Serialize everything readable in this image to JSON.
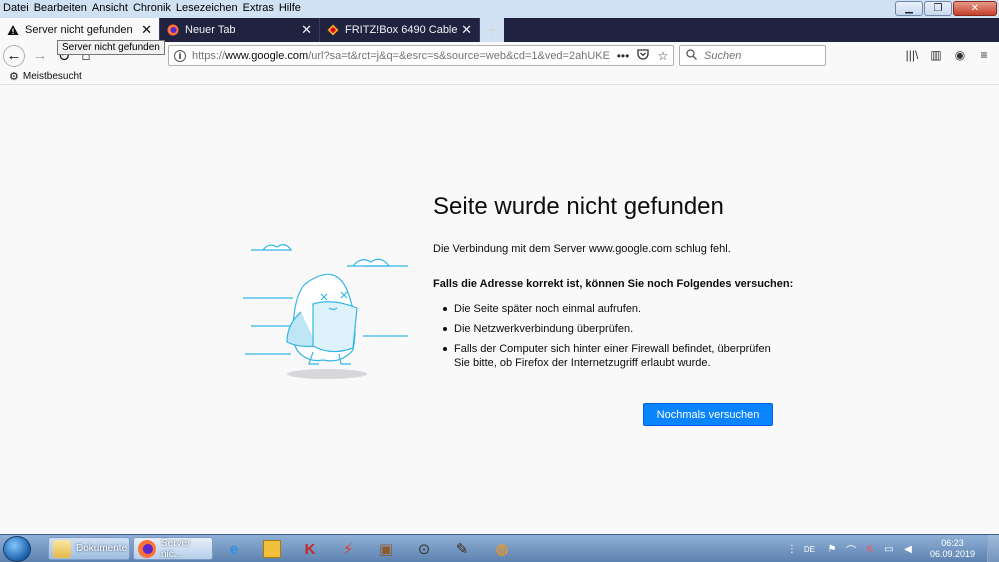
{
  "menubar": {
    "items": [
      "Datei",
      "Bearbeiten",
      "Ansicht",
      "Chronik",
      "Lesezeichen",
      "Extras",
      "Hilfe"
    ]
  },
  "tabs": [
    {
      "label": "Server nicht gefunden",
      "active": true,
      "icon": "warning-icon"
    },
    {
      "label": "Neuer Tab",
      "active": false,
      "icon": "firefox-icon"
    },
    {
      "label": "FRITZ!Box 6490 Cable",
      "active": false,
      "icon": "fritzbox-icon"
    }
  ],
  "tooltip": "Server nicht gefunden",
  "urlbar": {
    "scheme": "https://",
    "host": "www.google.com",
    "path": "/url?sa=t&rct=j&q=&esrc=s&source=web&cd=1&ved=2ahUKE"
  },
  "search": {
    "placeholder": "Suchen"
  },
  "bookmarks": {
    "most_visited": "Meistbesucht"
  },
  "error": {
    "title": "Seite wurde nicht gefunden",
    "description": "Die Verbindung mit dem Server www.google.com schlug fehl.",
    "hint": "Falls die Adresse korrekt ist, können Sie noch Folgendes versuchen:",
    "suggestions": [
      "Die Seite später noch einmal aufrufen.",
      "Die Netzwerkverbindung überprüfen.",
      "Falls der Computer sich hinter einer Firewall befindet, überprüfen Sie bitte, ob Firefox der Internetzugriff erlaubt wurde."
    ],
    "retry_label": "Nochmals versuchen"
  },
  "taskbar": {
    "items": [
      {
        "label": "Dokumente"
      },
      {
        "label": "Server nic..."
      }
    ],
    "tray": {
      "language": "DE",
      "time": "06:23",
      "date": "06.09.2019"
    }
  },
  "colors": {
    "accent": "#0a84ff",
    "tabstrip_bg": "#202340",
    "illustration": "#35b6e6"
  }
}
